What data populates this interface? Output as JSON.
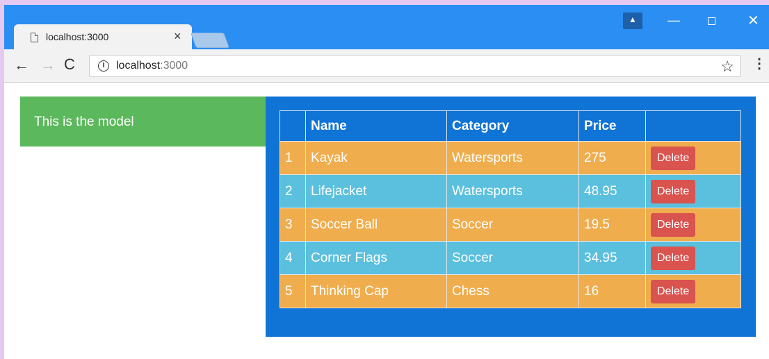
{
  "browser": {
    "tab_title": "localhost:3000",
    "tab_close": "×",
    "url_host": "localhost",
    "url_port": ":3000",
    "icons": {
      "back": "←",
      "forward": "→",
      "reload": "C",
      "info": "i",
      "star": "☆",
      "menu": "⋮",
      "minimize": "—",
      "close": "✕",
      "profile": "▲"
    }
  },
  "model_panel": {
    "text": "This is the model"
  },
  "table": {
    "headers": [
      "",
      "Name",
      "Category",
      "Price",
      ""
    ],
    "rows": [
      {
        "idx": "1",
        "name": "Kayak",
        "category": "Watersports",
        "price": "275",
        "action": "Delete"
      },
      {
        "idx": "2",
        "name": "Lifejacket",
        "category": "Watersports",
        "price": "48.95",
        "action": "Delete"
      },
      {
        "idx": "3",
        "name": "Soccer Ball",
        "category": "Soccer",
        "price": "19.5",
        "action": "Delete"
      },
      {
        "idx": "4",
        "name": "Corner Flags",
        "category": "Soccer",
        "price": "34.95",
        "action": "Delete"
      },
      {
        "idx": "5",
        "name": "Thinking Cap",
        "category": "Chess",
        "price": "16",
        "action": "Delete"
      }
    ]
  },
  "colors": {
    "chrome_blue": "#2b8ef3",
    "panel_green": "#5cb85c",
    "panel_blue": "#0f74d6",
    "row_orange": "#f0ad4e",
    "row_cyan": "#5bc0de",
    "delete_red": "#d9534f"
  }
}
